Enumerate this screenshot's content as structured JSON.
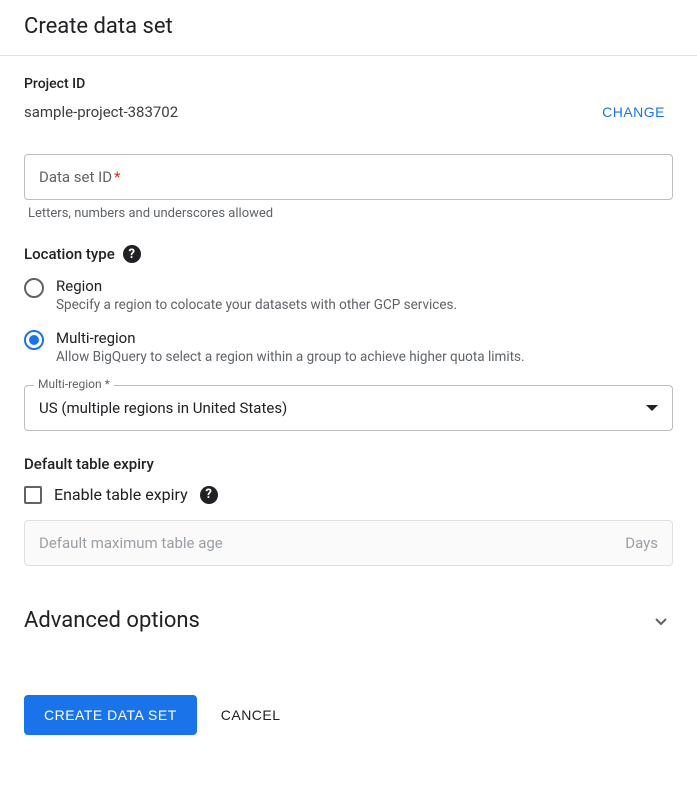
{
  "title": "Create data set",
  "project": {
    "label": "Project ID",
    "value": "sample-project-383702",
    "change_label": "CHANGE"
  },
  "dataset_id": {
    "placeholder": "Data set ID",
    "required_mark": "*",
    "helper": "Letters, numbers and underscores allowed"
  },
  "location": {
    "label": "Location type",
    "options": [
      {
        "label": "Region",
        "desc": "Specify a region to colocate your datasets with other GCP services.",
        "selected": false
      },
      {
        "label": "Multi-region",
        "desc": "Allow BigQuery to select a region within a group to achieve higher quota limits.",
        "selected": true
      }
    ],
    "select": {
      "legend": "Multi-region *",
      "value": "US (multiple regions in United States)"
    }
  },
  "expiry": {
    "heading": "Default table expiry",
    "checkbox_label": "Enable table expiry",
    "input_placeholder": "Default maximum table age",
    "unit": "Days"
  },
  "advanced": {
    "label": "Advanced options"
  },
  "footer": {
    "create": "CREATE DATA SET",
    "cancel": "CANCEL"
  }
}
